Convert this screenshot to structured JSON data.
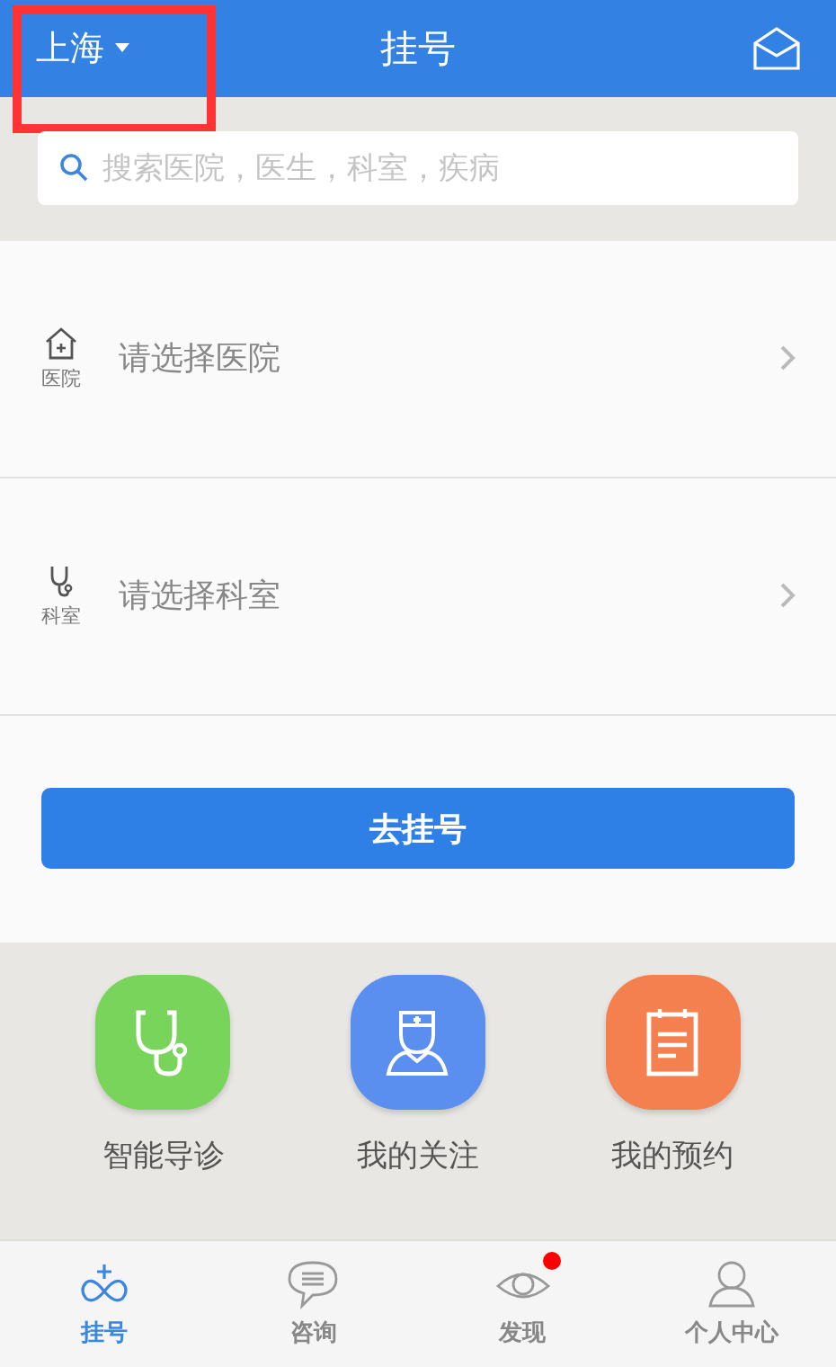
{
  "header": {
    "city": "上海",
    "title": "挂号"
  },
  "search": {
    "placeholder": "搜索医院，医生，科室，疾病"
  },
  "selectors": [
    {
      "label": "医院",
      "placeholder": "请选择医院"
    },
    {
      "label": "科室",
      "placeholder": "请选择科室"
    }
  ],
  "submit_button": "去挂号",
  "shortcuts": [
    {
      "label": "智能导诊",
      "color": "#78d45a"
    },
    {
      "label": "我的关注",
      "color": "#5a8ff0"
    },
    {
      "label": "我的预约",
      "color": "#f5804f"
    }
  ],
  "tabs": [
    {
      "label": "挂号",
      "selected": true,
      "badge": false
    },
    {
      "label": "咨询",
      "selected": false,
      "badge": false
    },
    {
      "label": "发现",
      "selected": false,
      "badge": true
    },
    {
      "label": "个人中心",
      "selected": false,
      "badge": false
    }
  ]
}
